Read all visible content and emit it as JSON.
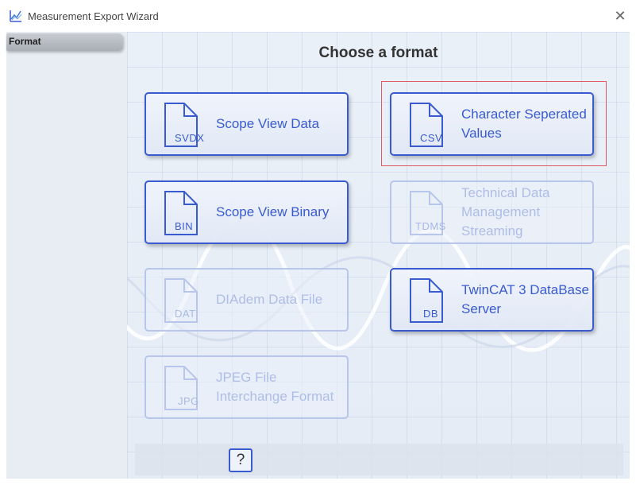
{
  "window": {
    "title": "Measurement Export Wizard",
    "close_label": "✕"
  },
  "sidebar": {
    "items": [
      {
        "label": "Format",
        "selected": true
      }
    ]
  },
  "main": {
    "heading": "Choose a format",
    "formats": [
      {
        "ext": "SVDX",
        "label": "Scope View Data",
        "enabled": true,
        "selected": false
      },
      {
        "ext": "CSV",
        "label": "Character Seperated Values",
        "enabled": true,
        "selected": true
      },
      {
        "ext": "BIN",
        "label": "Scope View Binary",
        "enabled": true,
        "selected": false
      },
      {
        "ext": "TDMS",
        "label": "Technical Data Management Streaming",
        "enabled": false,
        "selected": false
      },
      {
        "ext": "DAT",
        "label": "DIAdem Data File",
        "enabled": false,
        "selected": false
      },
      {
        "ext": "DB",
        "label": "TwinCAT 3 DataBase Server",
        "enabled": true,
        "selected": false
      },
      {
        "ext": "JPG",
        "label": "JPEG File Interchange Format",
        "enabled": false,
        "selected": false
      }
    ]
  },
  "footer": {
    "help_label": "?"
  },
  "colors": {
    "accent": "#3a5bd0",
    "selection": "#e05a63",
    "disabled": "#b7c6ea"
  },
  "icons": {
    "app": "chart-wave-icon",
    "file": "document-icon",
    "close": "close-icon"
  }
}
